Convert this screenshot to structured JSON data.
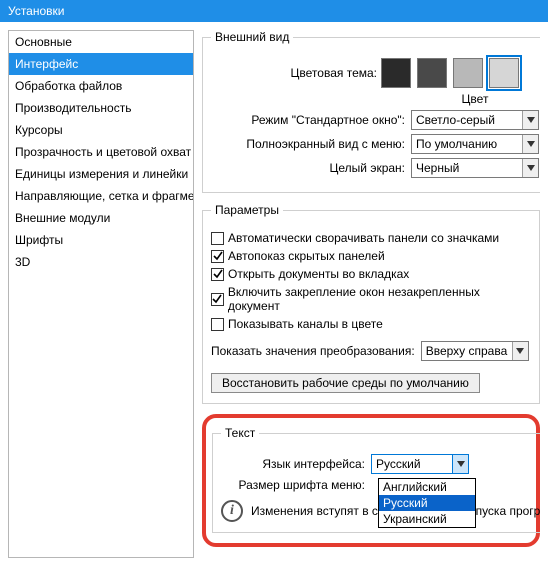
{
  "window": {
    "title": "Установки"
  },
  "sidebar": {
    "items": [
      {
        "label": "Основные"
      },
      {
        "label": "Интерфейс"
      },
      {
        "label": "Обработка файлов"
      },
      {
        "label": "Производительность"
      },
      {
        "label": "Курсоры"
      },
      {
        "label": "Прозрачность и цветовой охват"
      },
      {
        "label": "Единицы измерения и линейки"
      },
      {
        "label": "Направляющие, сетка и фрагменты"
      },
      {
        "label": "Внешние модули"
      },
      {
        "label": "Шрифты"
      },
      {
        "label": "3D"
      }
    ],
    "selected_index": 1
  },
  "appearance": {
    "legend": "Внешний вид",
    "theme_label": "Цветовая тема:",
    "swatches": [
      "#2a2a2a",
      "#494949",
      "#b8b8b8",
      "#d6d6d6"
    ],
    "swatch_selected": 3,
    "color_header": "Цвет",
    "rows": [
      {
        "label": "Режим \"Стандартное окно\":",
        "value": "Светло-серый"
      },
      {
        "label": "Полноэкранный вид с меню:",
        "value": "По умолчанию"
      },
      {
        "label": "Целый экран:",
        "value": "Черный"
      }
    ]
  },
  "params": {
    "legend": "Параметры",
    "checks": [
      {
        "label": "Автоматически сворачивать панели со значками",
        "checked": false
      },
      {
        "label": "Автопоказ скрытых панелей",
        "checked": true
      },
      {
        "label": "Открыть документы во вкладках",
        "checked": true
      },
      {
        "label": "Включить закрепление окон незакрепленных документ",
        "checked": true
      },
      {
        "label": "Показывать каналы в цвете",
        "checked": false
      }
    ],
    "transform_label": "Показать значения преобразования:",
    "transform_value": "Вверху справа",
    "restore_button": "Восстановить рабочие среды по умолчанию"
  },
  "text": {
    "legend": "Текст",
    "lang_label": "Язык интерфейса:",
    "lang_value": "Русский",
    "lang_options": [
      "Английский",
      "Русский",
      "Украинский"
    ],
    "lang_highlight_index": 1,
    "font_label": "Размер шрифта меню:",
    "info": "Изменения вступят в силу после перезапуска программы."
  }
}
